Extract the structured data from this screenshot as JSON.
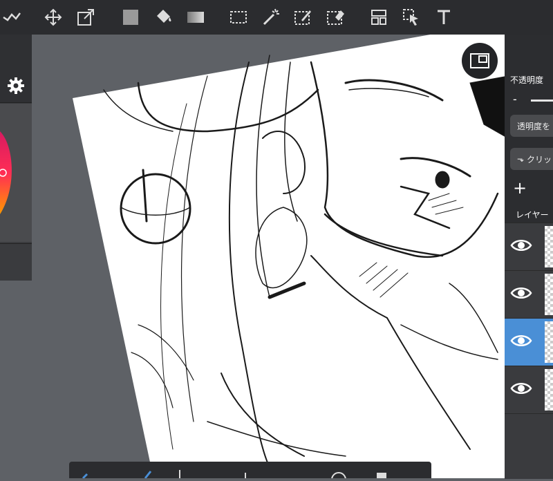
{
  "toolbar": {
    "items": [
      "stroke-tool",
      "move-tool",
      "transform-tool",
      "fill-color",
      "bucket-tool",
      "gradient-tool",
      "select-rect-tool",
      "magic-wand-tool",
      "select-pen-tool",
      "select-eraser-tool",
      "snap-tool",
      "select-layer-tool",
      "text-tool"
    ]
  },
  "right_panel": {
    "opacity_label": "不透明度",
    "opacity_minus": "-",
    "protect_alpha_label": "透明度を",
    "clip_label": "クリッ",
    "add_layer": "+",
    "layer_label": "レイヤー"
  },
  "layers": [
    {
      "visible": true,
      "active": false
    },
    {
      "visible": true,
      "active": false
    },
    {
      "visible": true,
      "active": true
    },
    {
      "visible": true,
      "active": false
    }
  ],
  "colors": {
    "toolbar_bg": "#2b2c2f",
    "canvas_bg": "#5e6166",
    "active_layer": "#4a8fd6"
  }
}
